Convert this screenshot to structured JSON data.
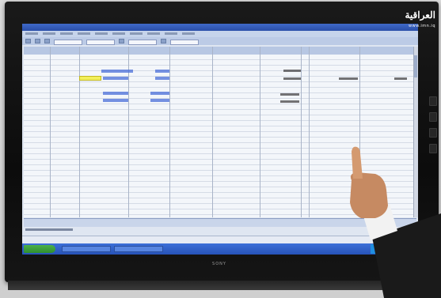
{
  "watermark": {
    "logo_text": "العراقية",
    "url_text": "www.imn.iq"
  },
  "monitor": {
    "brand": "SONY"
  },
  "colors": {
    "screen_bg": "#dfe6f1",
    "title_bar": "#2a4fa9",
    "taskbar": "#2753b8",
    "start_button": "#2f8f2e",
    "selected_cell": "#f2ef5a",
    "grid_value": "#4a6dd8"
  },
  "icons": [
    "pointing-hand",
    "start-button",
    "tray-icon"
  ]
}
